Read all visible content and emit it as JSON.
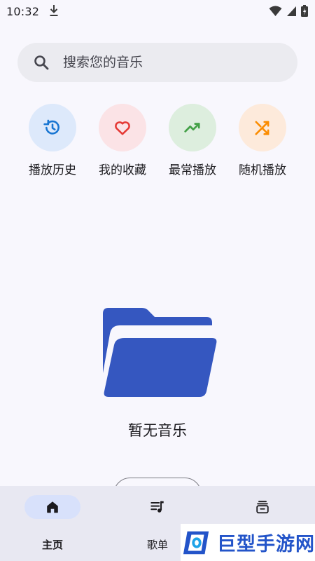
{
  "status_bar": {
    "time": "10:32"
  },
  "search": {
    "placeholder": "搜索您的音乐"
  },
  "quick_actions": [
    {
      "label": "播放历史",
      "icon": "history-icon",
      "bg": "#dde9fb",
      "color": "#1976d2"
    },
    {
      "label": "我的收藏",
      "icon": "heart-icon",
      "bg": "#fbe3e6",
      "color": "#e53935"
    },
    {
      "label": "最常播放",
      "icon": "trending-up-icon",
      "bg": "#ddeede",
      "color": "#43a047"
    },
    {
      "label": "随机播放",
      "icon": "shuffle-icon",
      "bg": "#fdeadb",
      "color": "#fb8c00"
    }
  ],
  "empty_state": {
    "text": "暂无音乐",
    "icon": "folder-open-icon",
    "color": "#3557c0"
  },
  "bottom_nav": {
    "items": [
      {
        "label": "主页",
        "icon": "home-icon",
        "active": true
      },
      {
        "label": "歌单",
        "icon": "playlist-icon",
        "active": false
      },
      {
        "label": "",
        "icon": "library-icon",
        "active": false
      }
    ]
  },
  "watermark": {
    "text": "巨型手游网"
  }
}
